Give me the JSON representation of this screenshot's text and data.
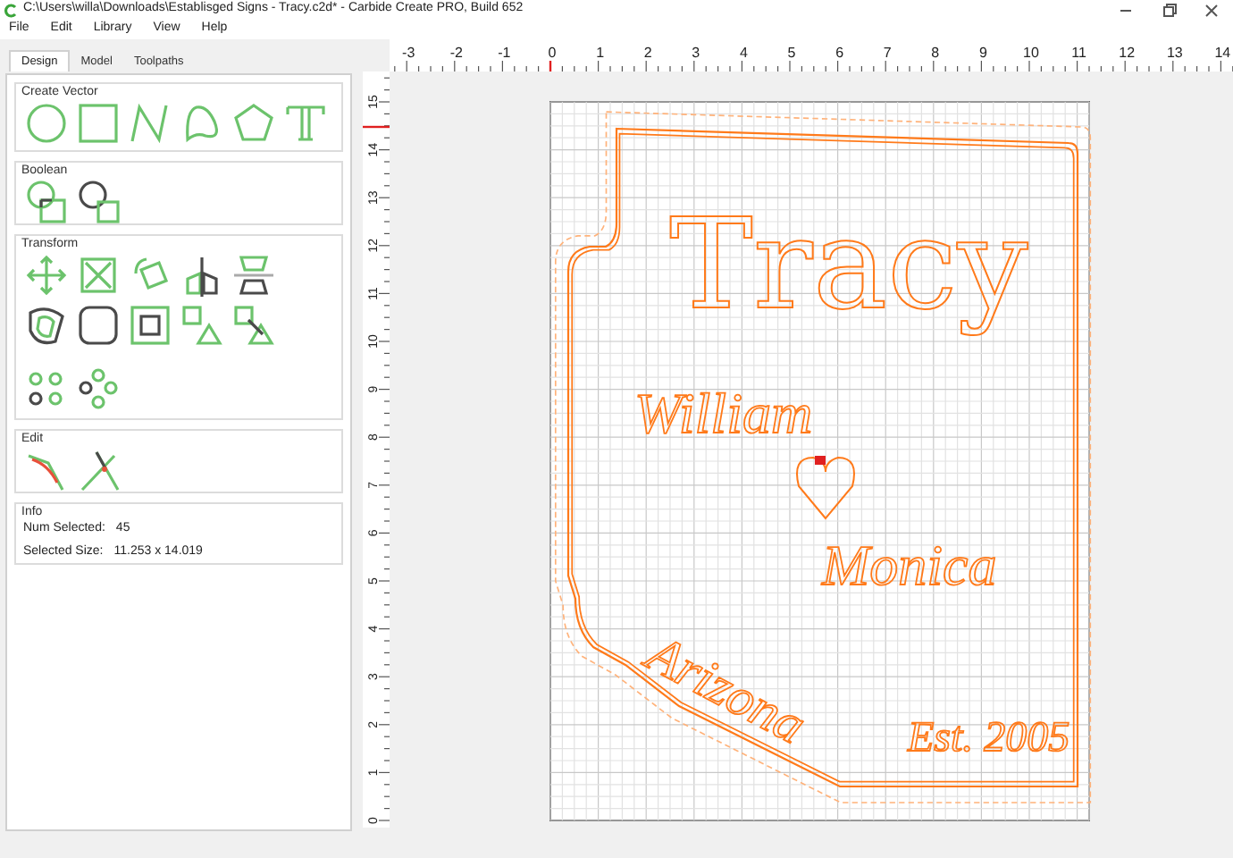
{
  "window": {
    "title": "C:\\Users\\willa\\Downloads\\Establisged Signs - Tracy.c2d* - Carbide Create PRO, Build 652"
  },
  "menu": [
    "File",
    "Edit",
    "Library",
    "View",
    "Help"
  ],
  "tabs": [
    {
      "label": "Design",
      "selected": true
    },
    {
      "label": "Model",
      "selected": false
    },
    {
      "label": "Toolpaths",
      "selected": false
    }
  ],
  "panels": [
    {
      "title": "Create Vector",
      "kind": "create_vector"
    },
    {
      "title": "Boolean",
      "kind": "boolean"
    },
    {
      "title": "Transform",
      "kind": "transform"
    },
    {
      "title": "Edit",
      "kind": "edit"
    },
    {
      "title": "Info",
      "kind": "info",
      "fields": [
        {
          "label": "Num Selected:",
          "value": "45"
        },
        {
          "label": "Selected Size:",
          "value": "11.253 x 14.019"
        }
      ]
    }
  ],
  "rulers": {
    "x_labels": [
      "-3",
      "-2",
      "-1",
      "0",
      "1",
      "2",
      "3",
      "4",
      "5",
      "6",
      "7",
      "8",
      "9",
      "10",
      "11",
      "12",
      "13",
      "14"
    ],
    "y_labels": [
      "15",
      "14",
      "13",
      "12",
      "11",
      "10",
      "9",
      "8",
      "7",
      "6",
      "5",
      "4",
      "3",
      "2",
      "1",
      "0"
    ]
  },
  "design": {
    "title": "Tracy",
    "names": [
      "William",
      "Monica"
    ],
    "state": "Arizona",
    "established": "Est. 2005"
  }
}
